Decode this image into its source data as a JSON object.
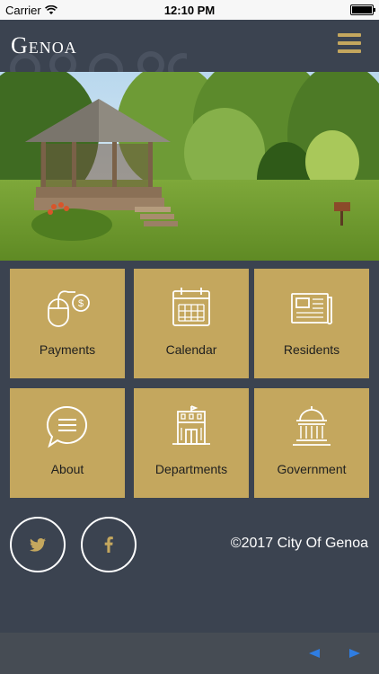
{
  "status_bar": {
    "carrier": "Carrier",
    "time": "12:10 PM"
  },
  "header": {
    "logo_text": "Genoa",
    "menu_icon": "hamburger-menu-icon"
  },
  "hero": {
    "image_alt": "gazebo-park-photo"
  },
  "tiles": [
    {
      "label": "Payments",
      "icon": "mouse-dollar-icon"
    },
    {
      "label": "Calendar",
      "icon": "calendar-icon"
    },
    {
      "label": "Residents",
      "icon": "newspaper-icon"
    },
    {
      "label": "About",
      "icon": "chat-bubble-icon"
    },
    {
      "label": "Departments",
      "icon": "building-icon"
    },
    {
      "label": "Government",
      "icon": "capitol-icon"
    }
  ],
  "social": {
    "twitter_icon": "twitter-icon",
    "facebook_icon": "facebook-icon"
  },
  "footer": {
    "copyright": "©2017 City Of Genoa"
  },
  "colors": {
    "background": "#3b4350",
    "tile": "#c4a75e",
    "accent": "#c4a75e",
    "nav_arrow": "#2f7de1"
  }
}
